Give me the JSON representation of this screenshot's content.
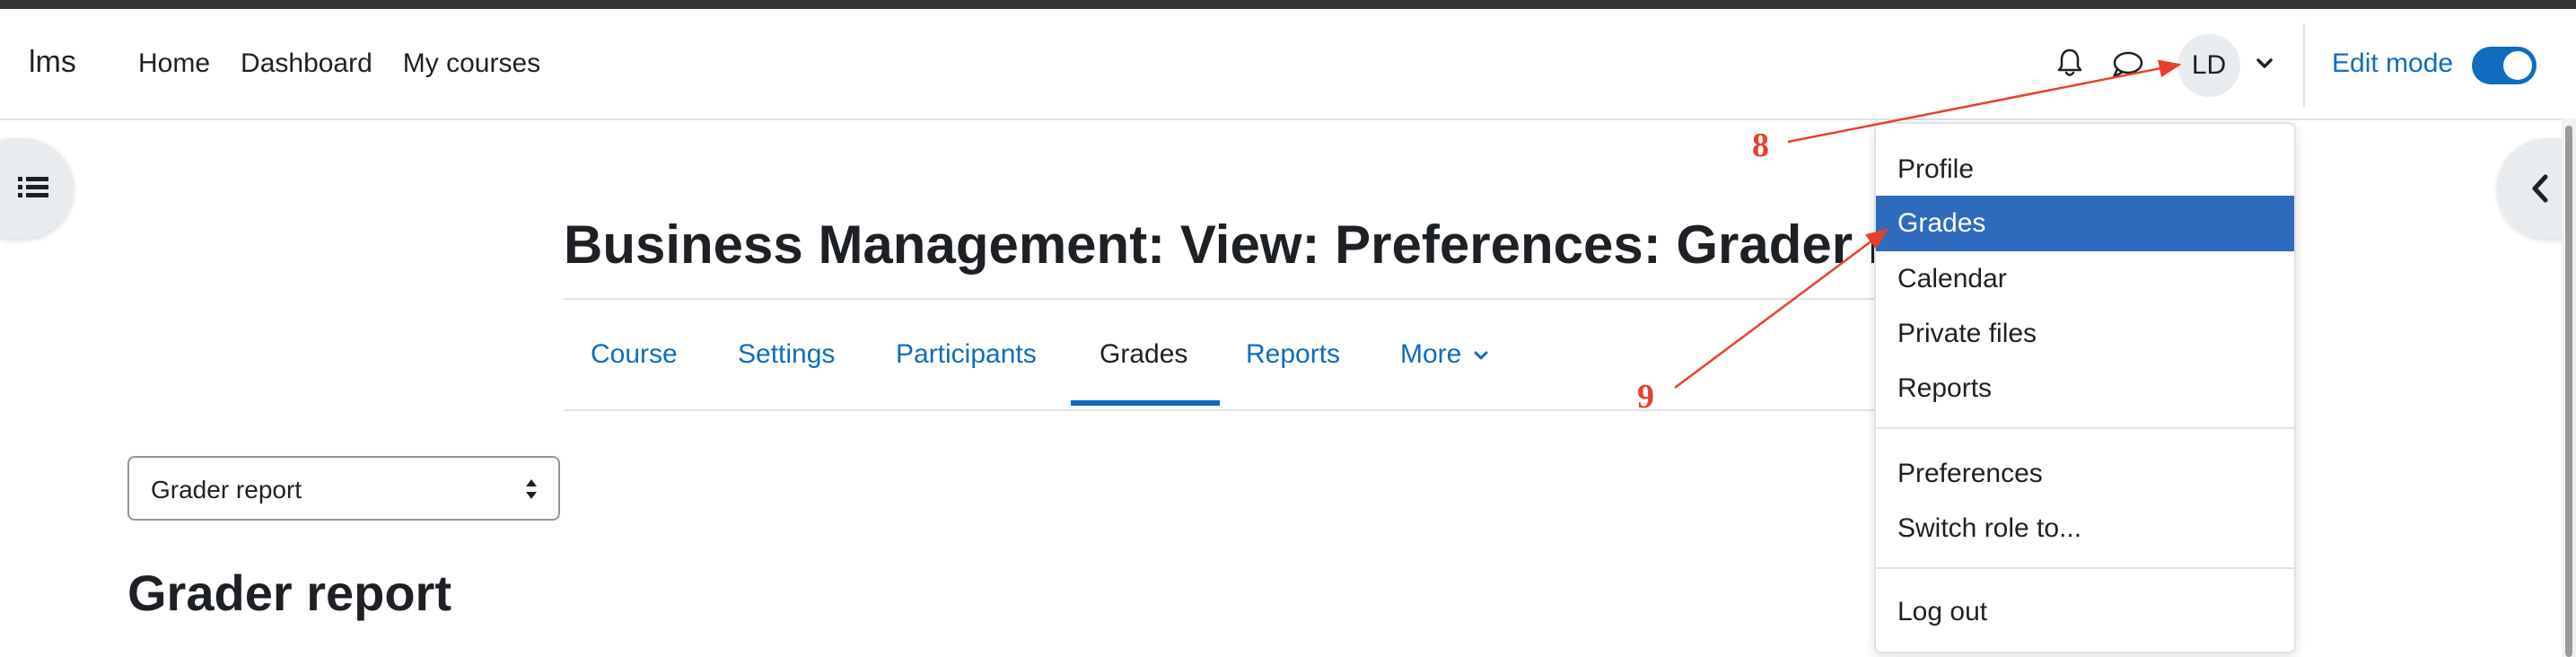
{
  "navbar": {
    "brand": "lms",
    "links": [
      "Home",
      "Dashboard",
      "My courses"
    ],
    "notifications_icon": "bell-icon",
    "messages_icon": "chat-bubble-icon",
    "user_initials": "LD",
    "user_menu_caret_icon": "chevron-down-icon",
    "edit_mode_label": "Edit mode",
    "edit_mode_on": true
  },
  "page": {
    "title": "Business Management: View: Preferences: Grader re",
    "secondary_nav": {
      "tabs": [
        "Course",
        "Settings",
        "Participants",
        "Grades",
        "Reports",
        "More"
      ],
      "active_tab": "Grades"
    },
    "report_selector": {
      "selected": "Grader report"
    },
    "section_title": "Grader report"
  },
  "user_menu": {
    "group1": [
      "Profile",
      "Grades",
      "Calendar",
      "Private files",
      "Reports"
    ],
    "group2": [
      "Preferences",
      "Switch role to..."
    ],
    "group3": [
      "Log out"
    ],
    "highlighted": "Grades"
  },
  "annotations": {
    "step_8": "8",
    "step_9": "9"
  },
  "colors": {
    "link": "#0f6cbf",
    "highlight": "#2f6bbd",
    "annotation": "#e8402d",
    "text": "#1d2125"
  }
}
